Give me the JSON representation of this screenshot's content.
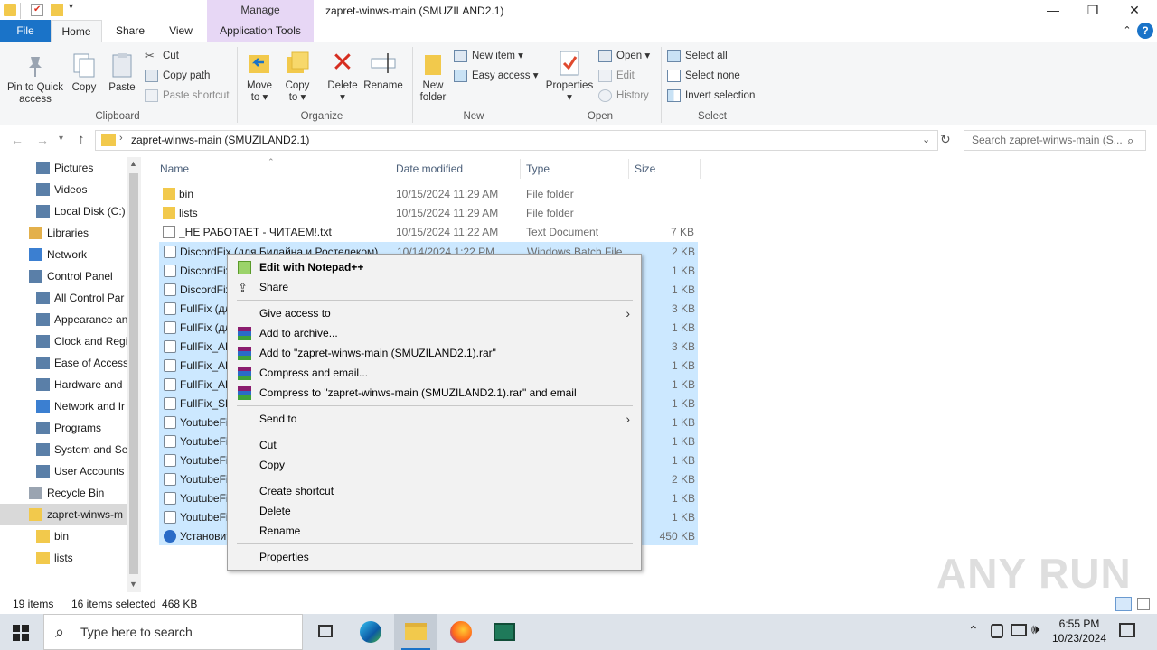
{
  "window": {
    "title": "zapret-winws-main (SMUZILAND2.1)",
    "manage_label": "Manage",
    "minimize": "—",
    "maximize": "❐",
    "close": "✕"
  },
  "tabs": {
    "file": "File",
    "home": "Home",
    "share": "Share",
    "view": "View",
    "app_tools": "Application Tools"
  },
  "ribbon": {
    "clipboard": {
      "pin": "Pin to Quick access",
      "copy": "Copy",
      "paste": "Paste",
      "cut": "Cut",
      "copy_path": "Copy path",
      "paste_shortcut": "Paste shortcut",
      "label": "Clipboard"
    },
    "organize": {
      "move_to": "Move to",
      "copy_to": "Copy to",
      "delete": "Delete",
      "rename": "Rename",
      "label": "Organize"
    },
    "new": {
      "new_folder": "New folder",
      "new_item": "New item",
      "easy_access": "Easy access",
      "label": "New"
    },
    "open": {
      "properties": "Properties",
      "open": "Open",
      "edit": "Edit",
      "history": "History",
      "label": "Open"
    },
    "select": {
      "select_all": "Select all",
      "select_none": "Select none",
      "invert": "Invert selection",
      "label": "Select"
    }
  },
  "address": {
    "path": "zapret-winws-main (SMUZILAND2.1)",
    "search_placeholder": "Search zapret-winws-main (S..."
  },
  "nav": [
    {
      "label": "Pictures",
      "icon": "pictures-icon"
    },
    {
      "label": "Videos",
      "icon": "videos-icon"
    },
    {
      "label": "Local Disk (C:)",
      "icon": "drive-icon"
    },
    {
      "label": "Libraries",
      "icon": "libraries-icon"
    },
    {
      "label": "Network",
      "icon": "network-icon"
    },
    {
      "label": "Control Panel",
      "icon": "control-panel-icon"
    },
    {
      "label": "All Control Par",
      "icon": "control-panel-icon"
    },
    {
      "label": "Appearance an",
      "icon": "appearance-icon"
    },
    {
      "label": "Clock and Regi",
      "icon": "clock-icon"
    },
    {
      "label": "Ease of Access",
      "icon": "ease-access-icon"
    },
    {
      "label": "Hardware and",
      "icon": "hardware-icon"
    },
    {
      "label": "Network and Ir",
      "icon": "network-icon"
    },
    {
      "label": "Programs",
      "icon": "programs-icon"
    },
    {
      "label": "System and Se",
      "icon": "system-icon"
    },
    {
      "label": "User Accounts",
      "icon": "users-icon"
    },
    {
      "label": "Recycle Bin",
      "icon": "recycle-bin-icon"
    },
    {
      "label": "zapret-winws-m",
      "icon": "folder-icon"
    },
    {
      "label": "bin",
      "icon": "folder-icon"
    },
    {
      "label": "lists",
      "icon": "folder-icon"
    }
  ],
  "columns": {
    "name": "Name",
    "date": "Date modified",
    "type": "Type",
    "size": "Size"
  },
  "files": [
    {
      "name": "bin",
      "date": "10/15/2024 11:29 AM",
      "type": "File folder",
      "size": "",
      "kind": "folder"
    },
    {
      "name": "lists",
      "date": "10/15/2024 11:29 AM",
      "type": "File folder",
      "size": "",
      "kind": "folder"
    },
    {
      "name": "_НЕ РАБОТАЕТ - ЧИТАЕМ!.txt",
      "date": "10/15/2024 11:22 AM",
      "type": "Text Document",
      "size": "7 KB",
      "kind": "txt"
    },
    {
      "name": "DiscordFix (для Билайна и Ростелеком)",
      "date": "10/14/2024 1:22 PM",
      "type": "Windows Batch File",
      "size": "2 KB",
      "kind": "bat"
    },
    {
      "name": "DiscordFix",
      "date": "",
      "type": "",
      "size": "1 KB",
      "kind": "bat"
    },
    {
      "name": "DiscordFix",
      "date": "",
      "type": "",
      "size": "1 KB",
      "kind": "bat"
    },
    {
      "name": "FullFix (дл",
      "date": "",
      "type": "",
      "size": "3 KB",
      "kind": "bat"
    },
    {
      "name": "FullFix (дл",
      "date": "",
      "type": "",
      "size": "1 KB",
      "kind": "bat"
    },
    {
      "name": "FullFix_AL",
      "date": "",
      "type": "",
      "size": "3 KB",
      "kind": "bat"
    },
    {
      "name": "FullFix_AL",
      "date": "",
      "type": "",
      "size": "1 KB",
      "kind": "bat"
    },
    {
      "name": "FullFix_AL",
      "date": "",
      "type": "",
      "size": "1 KB",
      "kind": "bat"
    },
    {
      "name": "FullFix_SM",
      "date": "",
      "type": "",
      "size": "1 KB",
      "kind": "bat"
    },
    {
      "name": "YoutubeFi",
      "date": "",
      "type": "",
      "size": "1 KB",
      "kind": "bat"
    },
    {
      "name": "YoutubeFi",
      "date": "",
      "type": "",
      "size": "1 KB",
      "kind": "bat"
    },
    {
      "name": "YoutubeFi",
      "date": "",
      "type": "",
      "size": "1 KB",
      "kind": "bat"
    },
    {
      "name": "YoutubeFi",
      "date": "",
      "type": "",
      "size": "2 KB",
      "kind": "bat"
    },
    {
      "name": "YoutubeFi",
      "date": "",
      "type": "",
      "size": "1 KB",
      "kind": "bat"
    },
    {
      "name": "YoutubeFi",
      "date": "",
      "type": "",
      "size": "1 KB",
      "kind": "bat"
    },
    {
      "name": "Установит",
      "date": "",
      "type": "",
      "size": "450 KB",
      "kind": "exe"
    }
  ],
  "context_menu": {
    "edit_notepad": "Edit with Notepad++",
    "share": "Share",
    "give_access": "Give access to",
    "add_archive": "Add to archive...",
    "add_rar": "Add to \"zapret-winws-main (SMUZILAND2.1).rar\"",
    "compress_email": "Compress and email...",
    "compress_rar_email": "Compress to \"zapret-winws-main (SMUZILAND2.1).rar\" and email",
    "send_to": "Send to",
    "cut": "Cut",
    "copy": "Copy",
    "create_shortcut": "Create shortcut",
    "delete": "Delete",
    "rename": "Rename",
    "properties": "Properties"
  },
  "status": {
    "items": "19 items",
    "selected": "16 items selected  468 KB"
  },
  "watermark": "ANY RUN",
  "taskbar": {
    "search_placeholder": "Type here to search",
    "time": "6:55 PM",
    "date": "10/23/2024"
  }
}
